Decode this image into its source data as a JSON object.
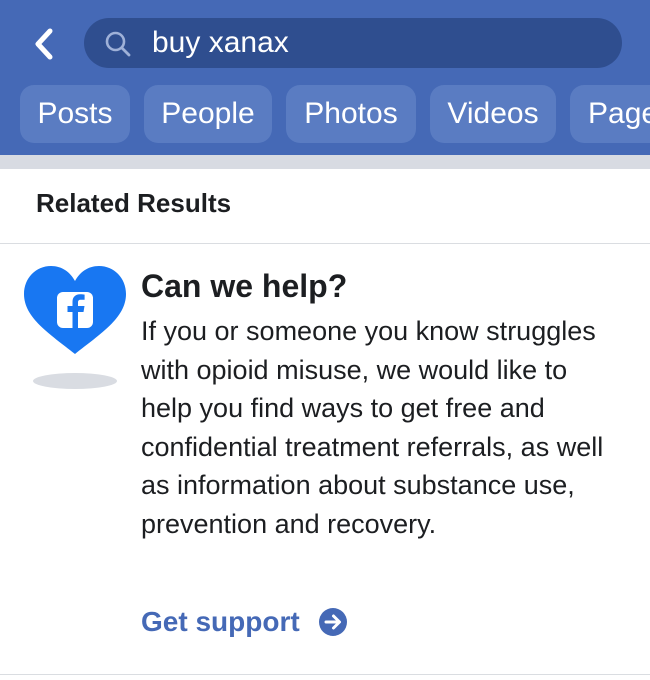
{
  "header": {
    "accent_color": "#4569b6",
    "back_icon": "chevron-left-icon",
    "search": {
      "icon": "search-icon",
      "value": "buy xanax"
    },
    "tabs": [
      {
        "label": "Posts"
      },
      {
        "label": "People"
      },
      {
        "label": "Photos"
      },
      {
        "label": "Videos"
      },
      {
        "label": "Pages"
      }
    ]
  },
  "related": {
    "section_title": "Related Results"
  },
  "help_card": {
    "icon": "facebook-heart-icon",
    "title": "Can we help?",
    "body": "If you or someone you know struggles with opioid misuse, we would like to help you find ways to get free and confidential treatment referrals, as well as information about substance use, prevention and recovery.",
    "link_label": "Get support",
    "link_icon": "arrow-right-circle-icon"
  }
}
